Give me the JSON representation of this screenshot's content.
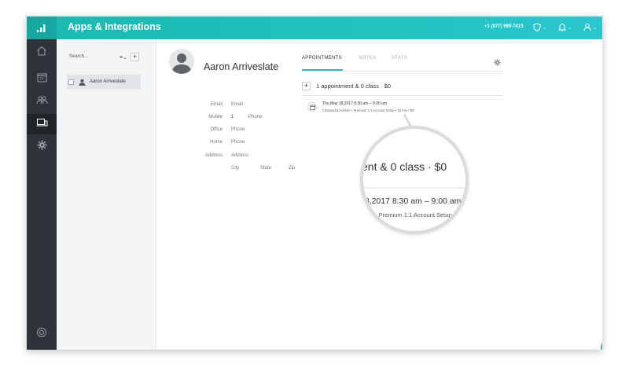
{
  "header": {
    "title": "Apps & Integrations",
    "phone": "+1 (877) 989-7413",
    "icons": [
      "logo-icon",
      "shield-icon",
      "bell-icon",
      "user-icon"
    ]
  },
  "sidebar": {
    "items": [
      {
        "name": "home-icon"
      },
      {
        "name": "calendar-icon",
        "label": "31"
      },
      {
        "name": "people-icon"
      },
      {
        "name": "devices-icon",
        "active": true
      },
      {
        "name": "gear-icon"
      },
      {
        "name": "help-ring-icon"
      }
    ]
  },
  "list": {
    "search_placeholder": "Search...",
    "contacts": [
      {
        "name": "Aaron Arriveslate"
      }
    ]
  },
  "contact": {
    "name": "Aaron Arriveslate",
    "fields": {
      "email_label": "Email",
      "email_value": "Email",
      "mobile_label": "Mobile",
      "mobile_code": "1",
      "mobile_value": "Phone",
      "office_label": "Office",
      "office_value": "Phone",
      "home_label": "Home",
      "home_value": "Phone",
      "address_label": "Address",
      "address_value": "Address",
      "city": "City",
      "state": "State",
      "zip": "Zip"
    }
  },
  "tabs": {
    "appointments": "APPOINTMENTS",
    "notes": "NOTES",
    "stats": "STATS"
  },
  "appointments": {
    "summary": "1 appointment & 0 class  ·  $0",
    "items": [
      {
        "time": "Thu May 18,2017 8:30 am – 9:00 am",
        "details": "Cassandra Koehler • Premium 1:1 Account Setup • 15 min • $0"
      }
    ]
  },
  "magnifier": {
    "line1": "ent & 0 class  ·  $0",
    "line2": "18,2017 8:30 am – 9:00 am",
    "line3": "oehler • Premium 1:1 Account Setup"
  },
  "colors": {
    "header": "#1ab9b0",
    "sidebar": "#2d3339",
    "accent": "#25b9c4"
  }
}
